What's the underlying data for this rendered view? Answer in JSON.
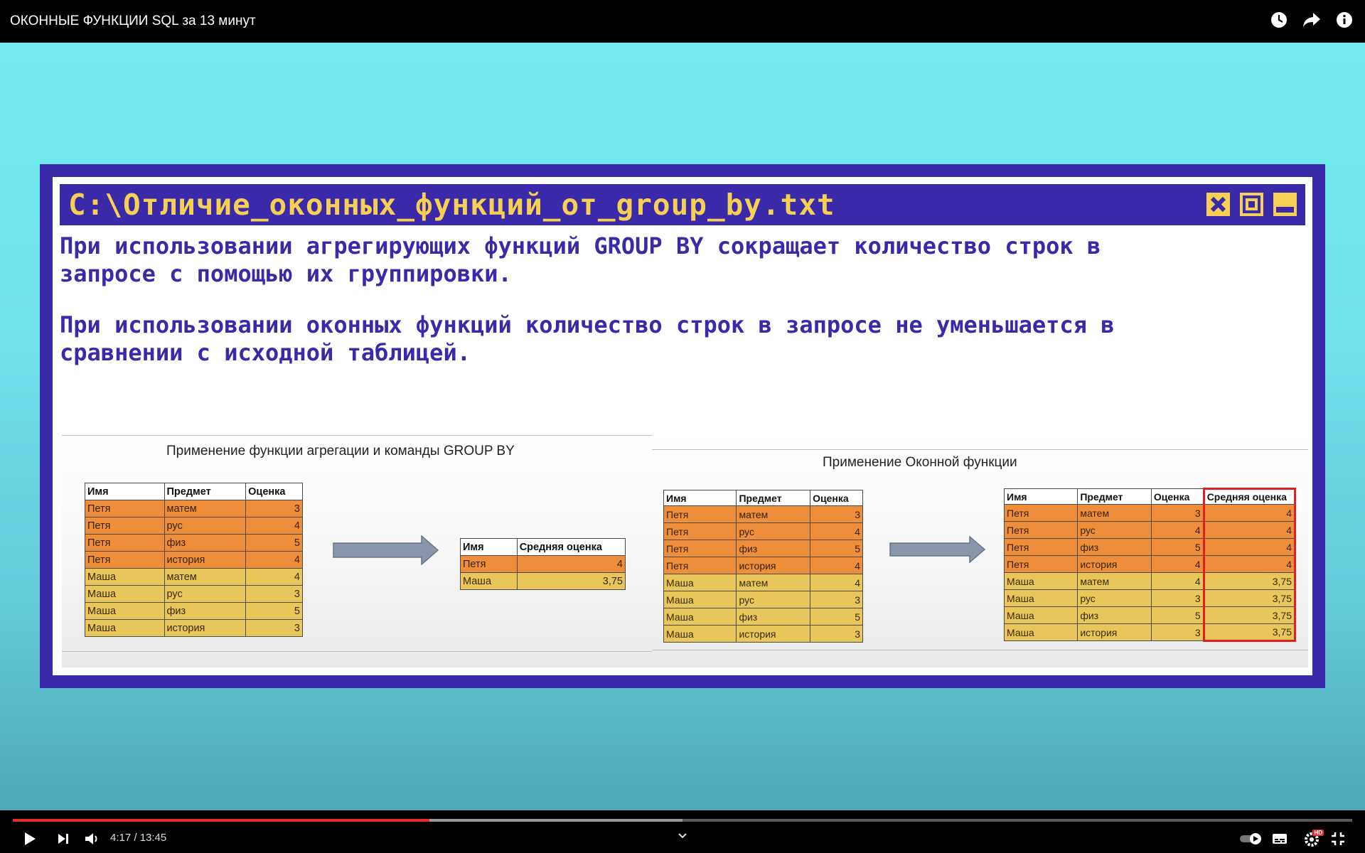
{
  "header": {
    "title": "ОКОННЫЕ ФУНКЦИИ SQL за 13 минут",
    "icons": [
      "clock-icon",
      "share-icon",
      "info-icon"
    ]
  },
  "window": {
    "title": "C:\\Отличие_оконных_функций_от_group_by.txt",
    "paragraph1": "При использовании агрегирующих функций GROUP BY сокращает количество строк в\nзапросе с помощью их группировки.",
    "paragraph2": "При использовании оконных функций количество строк в запросе не уменьшается в\nсравнении с исходной таблицей.",
    "controls": [
      "close-icon",
      "maximize-icon",
      "minimize-icon"
    ]
  },
  "left": {
    "title": "Применение функции агрегации и команды GROUP BY",
    "source": {
      "headers": [
        "Имя",
        "Предмет",
        "Оценка"
      ],
      "rows": [
        [
          "Петя",
          "матем",
          "3"
        ],
        [
          "Петя",
          "рус",
          "4"
        ],
        [
          "Петя",
          "физ",
          "5"
        ],
        [
          "Петя",
          "история",
          "4"
        ],
        [
          "Маша",
          "матем",
          "4"
        ],
        [
          "Маша",
          "рус",
          "3"
        ],
        [
          "Маша",
          "физ",
          "5"
        ],
        [
          "Маша",
          "история",
          "3"
        ]
      ]
    },
    "result": {
      "headers": [
        "Имя",
        "Средняя оценка"
      ],
      "rows": [
        [
          "Петя",
          "4"
        ],
        [
          "Маша",
          "3,75"
        ]
      ]
    }
  },
  "right": {
    "title": "Применение Оконной функции",
    "source": {
      "headers": [
        "Имя",
        "Предмет",
        "Оценка"
      ],
      "rows": [
        [
          "Петя",
          "матем",
          "3"
        ],
        [
          "Петя",
          "рус",
          "4"
        ],
        [
          "Петя",
          "физ",
          "5"
        ],
        [
          "Петя",
          "история",
          "4"
        ],
        [
          "Маша",
          "матем",
          "4"
        ],
        [
          "Маша",
          "рус",
          "3"
        ],
        [
          "Маша",
          "физ",
          "5"
        ],
        [
          "Маша",
          "история",
          "3"
        ]
      ]
    },
    "result": {
      "headers": [
        "Имя",
        "Предмет",
        "Оценка",
        "Средняя оценка"
      ],
      "rows": [
        [
          "Петя",
          "матем",
          "3",
          "4"
        ],
        [
          "Петя",
          "рус",
          "4",
          "4"
        ],
        [
          "Петя",
          "физ",
          "5",
          "4"
        ],
        [
          "Петя",
          "история",
          "4",
          "4"
        ],
        [
          "Маша",
          "матем",
          "4",
          "3,75"
        ],
        [
          "Маша",
          "рус",
          "3",
          "3,75"
        ],
        [
          "Маша",
          "физ",
          "5",
          "3,75"
        ],
        [
          "Маша",
          "история",
          "3",
          "3,75"
        ]
      ]
    }
  },
  "colors": {
    "petya_row": "#ee8d3a",
    "masha_row": "#e9c65a",
    "window_blue": "#3a2aa9",
    "title_yellow": "#f6cf55",
    "highlight": "#e02020"
  },
  "player": {
    "time": "4:17 / 13:45",
    "played_fraction": 0.311,
    "buffered_fraction": 0.5,
    "badge": "HD",
    "icons": [
      "play-icon",
      "next-icon",
      "volume-icon",
      "chevron-down-icon",
      "autoplay-toggle-icon",
      "subtitles-icon",
      "settings-icon",
      "exit-fullscreen-icon"
    ]
  }
}
